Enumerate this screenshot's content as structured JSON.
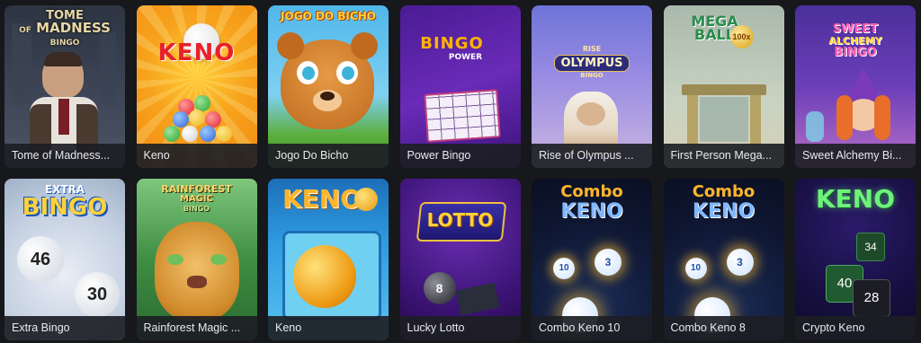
{
  "games": [
    {
      "title": "Tome of Madness...",
      "logo": [
        "TOME",
        "MADNESS",
        "BINGO"
      ],
      "logo_of": "OF"
    },
    {
      "title": "Keno",
      "logo": "KENO"
    },
    {
      "title": "Jogo Do Bicho",
      "logo": "JOGO DO BICHO"
    },
    {
      "title": "Power Bingo",
      "logo": "BINGO",
      "logo_sub": "POWER"
    },
    {
      "title": "Rise of Olympus ...",
      "logo": [
        "RISE",
        "OLYMPUS",
        "BINGO"
      ]
    },
    {
      "title": "First Person Mega...",
      "logo": [
        "MEGA",
        "BALL"
      ],
      "badge": "100x"
    },
    {
      "title": "Sweet Alchemy Bi...",
      "logo": [
        "SWEET",
        "ALCHEMY",
        "BINGO"
      ]
    },
    {
      "title": "Extra Bingo",
      "logo": [
        "EXTRA",
        "BINGO"
      ],
      "balls": [
        "46",
        "30"
      ]
    },
    {
      "title": "Rainforest Magic ...",
      "logo": [
        "RAINFOREST",
        "MAGIC",
        "BINGO"
      ]
    },
    {
      "title": "Keno",
      "logo": "KENO"
    },
    {
      "title": "Lucky Lotto",
      "logo": "LOTTO",
      "ball": "8"
    },
    {
      "title": "Combo Keno 10",
      "logo": [
        "Combo",
        "KENO"
      ],
      "balls": [
        "10",
        "3"
      ]
    },
    {
      "title": "Combo Keno 8",
      "logo": [
        "Combo",
        "KENO"
      ],
      "balls": [
        "10",
        "3"
      ]
    },
    {
      "title": "Crypto Keno",
      "logo": "KENO",
      "cards": [
        "34",
        "40",
        "28"
      ]
    }
  ],
  "colors": {
    "background": "#17181c",
    "label_bg": "#1c1e24",
    "label_text": "#e9eaee"
  }
}
